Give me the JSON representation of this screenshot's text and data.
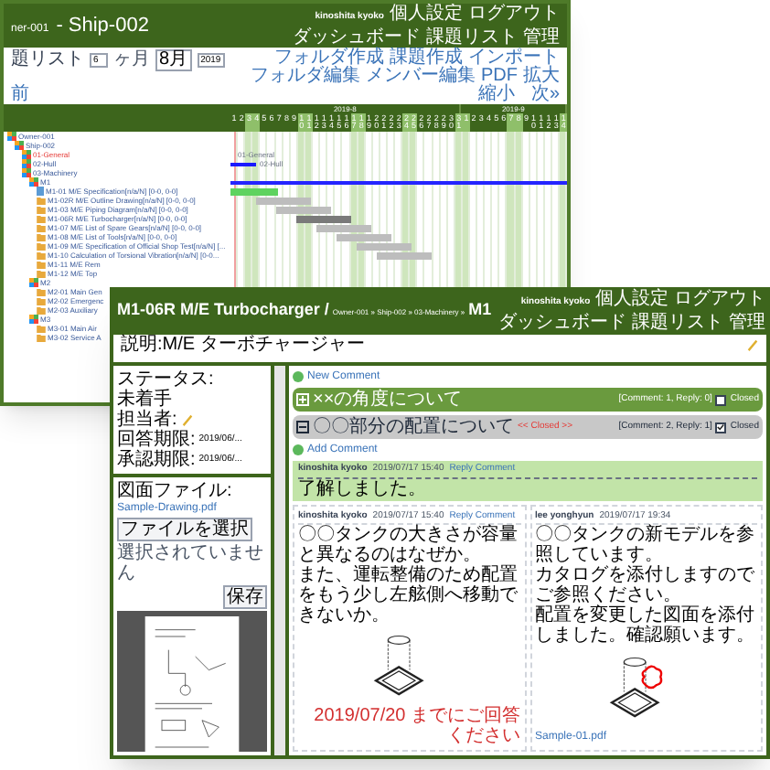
{
  "back_window": {
    "header": {
      "owner": "ner-001",
      "ship": "- Ship-002",
      "user": "kinoshita kyoko",
      "menu_top": [
        "個人設定",
        "ログアウト"
      ],
      "menu_bottom": [
        "ダッシュボード",
        "課題リスト",
        "管理"
      ]
    },
    "toolbar": {
      "title": "題リスト",
      "months": "6",
      "months_label": "ヶ月",
      "month": "8月",
      "year": "2019",
      "actions": [
        "フォルダ作成",
        "課題作成",
        "インポート",
        "フォルダ編集",
        "メンバー編集",
        "PDF",
        "拡大",
        "縮小"
      ]
    },
    "nav": {
      "prev": "前",
      "next": "次»"
    },
    "gantt": {
      "months": [
        "2019-8",
        "2019-9"
      ],
      "days": [
        {
          "label": "1",
          "weekend": false
        },
        {
          "label": "2",
          "weekend": false
        },
        {
          "label": "3",
          "weekend": true
        },
        {
          "label": "4",
          "weekend": true
        },
        {
          "label": "5",
          "weekend": false
        },
        {
          "label": "6",
          "weekend": false
        },
        {
          "label": "7",
          "weekend": false
        },
        {
          "label": "8",
          "weekend": false
        },
        {
          "label": "9",
          "weekend": false
        },
        {
          "label": "10",
          "weekend": true
        },
        {
          "label": "11",
          "weekend": true
        },
        {
          "label": "12",
          "weekend": false
        },
        {
          "label": "13",
          "weekend": false
        },
        {
          "label": "14",
          "weekend": false
        },
        {
          "label": "15",
          "weekend": false
        },
        {
          "label": "16",
          "weekend": false
        },
        {
          "label": "17",
          "weekend": true
        },
        {
          "label": "18",
          "weekend": true
        },
        {
          "label": "19",
          "weekend": false
        },
        {
          "label": "20",
          "weekend": false
        },
        {
          "label": "21",
          "weekend": false
        },
        {
          "label": "22",
          "weekend": false
        },
        {
          "label": "23",
          "weekend": false
        },
        {
          "label": "24",
          "weekend": true
        },
        {
          "label": "25",
          "weekend": true
        },
        {
          "label": "26",
          "weekend": false
        },
        {
          "label": "27",
          "weekend": false
        },
        {
          "label": "28",
          "weekend": false
        },
        {
          "label": "29",
          "weekend": false
        },
        {
          "label": "30",
          "weekend": false
        },
        {
          "label": "31",
          "weekend": true
        },
        {
          "label": "1",
          "weekend": true
        },
        {
          "label": "2",
          "weekend": false
        },
        {
          "label": "3",
          "weekend": false
        },
        {
          "label": "4",
          "weekend": false
        },
        {
          "label": "5",
          "weekend": false
        },
        {
          "label": "6",
          "weekend": false
        },
        {
          "label": "7",
          "weekend": true
        },
        {
          "label": "8",
          "weekend": true
        },
        {
          "label": "9",
          "weekend": false
        },
        {
          "label": "10",
          "weekend": false
        },
        {
          "label": "11",
          "weekend": false
        },
        {
          "label": "12",
          "weekend": false
        },
        {
          "label": "13",
          "weekend": false
        },
        {
          "label": "14",
          "weekend": true
        }
      ]
    },
    "tree": [
      {
        "kind": "group",
        "label": "Owner-001",
        "highlighted": false,
        "children": [
          {
            "kind": "group",
            "label": "Ship-002",
            "highlighted": false,
            "children": [
              {
                "kind": "group",
                "label": "01-General",
                "highlighted": true,
                "bar": {
                  "kind": "label",
                  "label": "01-General"
                }
              },
              {
                "kind": "group",
                "label": "02-Hull",
                "highlighted": false,
                "bar": {
                  "kind": "short",
                  "label": "02-Hull"
                }
              },
              {
                "kind": "group",
                "label": "03-Machinery",
                "highlighted": false,
                "children": [
                  {
                    "kind": "group",
                    "label": "M1",
                    "highlighted": false,
                    "bar": {
                      "kind": "summary"
                    },
                    "children": [
                      {
                        "kind": "doc",
                        "label": "M1-01 M/E Specification[n/a/N] [0-0, 0-0]",
                        "highlighted": false,
                        "bar": {
                          "kind": "done"
                        }
                      },
                      {
                        "kind": "folder",
                        "label": "M1-02R M/E Outline Drawing[n/a/N] [0-0, 0-0]",
                        "highlighted": false,
                        "bar": {
                          "kind": "plan"
                        }
                      },
                      {
                        "kind": "folder",
                        "label": "M1-03 M/E Piping Diagram[n/a/N] [0-0, 0-0]",
                        "highlighted": false,
                        "bar": {
                          "kind": "plan"
                        }
                      },
                      {
                        "kind": "folder",
                        "label": "M1-06R M/E Turbocharger[n/a/N] [0-0, 0-0]",
                        "highlighted": false,
                        "bar": {
                          "kind": "current"
                        }
                      },
                      {
                        "kind": "folder",
                        "label": "M1-07 M/E List of Spare Gears[n/a/N] [0-0, 0-0]",
                        "highlighted": false,
                        "bar": {
                          "kind": "plan"
                        }
                      },
                      {
                        "kind": "folder",
                        "label": "M1-08 M/E List of Tools[n/a/N] [0-0, 0-0]",
                        "highlighted": false,
                        "bar": {
                          "kind": "plan"
                        }
                      },
                      {
                        "kind": "folder",
                        "label": "M1-09 M/E Specification of Official Shop Test[n/a/N] [...",
                        "highlighted": false,
                        "bar": {
                          "kind": "plan"
                        }
                      },
                      {
                        "kind": "folder",
                        "label": "M1-10 Calculation of Torsional Vibration[n/a/N] [0-0...",
                        "highlighted": false,
                        "bar": {
                          "kind": "plan"
                        }
                      },
                      {
                        "kind": "folder",
                        "label": "M1-11 M/E Rem",
                        "highlighted": false
                      },
                      {
                        "kind": "folder",
                        "label": "M1-12 M/E Top",
                        "highlighted": false
                      }
                    ]
                  },
                  {
                    "kind": "group",
                    "label": "M2",
                    "highlighted": false,
                    "children": [
                      {
                        "kind": "folder",
                        "label": "M2-01 Main Gen",
                        "highlighted": false
                      },
                      {
                        "kind": "folder",
                        "label": "M2-02 Emergenc",
                        "highlighted": false
                      },
                      {
                        "kind": "folder",
                        "label": "M2-03 Auxiliary",
                        "highlighted": false
                      }
                    ]
                  },
                  {
                    "kind": "group",
                    "label": "M3",
                    "highlighted": false,
                    "children": [
                      {
                        "kind": "folder",
                        "label": "M3-01 Main Air",
                        "highlighted": false
                      },
                      {
                        "kind": "folder",
                        "label": "M3-02 Service A",
                        "highlighted": false
                      }
                    ]
                  }
                ]
              }
            ]
          }
        ]
      }
    ]
  },
  "front_window": {
    "header": {
      "title": "M1-06R M/E Turbocharger /",
      "breadcrumb": "Owner-001 » Ship-002 » 03-Machinery »",
      "node": "M1",
      "user": "kinoshita kyoko",
      "menu_top": [
        "個人設定",
        "ログアウト"
      ],
      "menu_bottom": [
        "ダッシュボード",
        "課題リスト",
        "管理"
      ]
    },
    "description": "説明:M/E ターボチャージャー",
    "status": {
      "status_label": "ステータス:",
      "status": "未着手",
      "assignee_label": "担当者:",
      "answer_label": "回答期限:",
      "answer_date": "2019/06/...",
      "approval_label": "承認期限:",
      "approval_date": "2019/06/..."
    },
    "file": {
      "label": "図面ファイル:",
      "name": "Sample-Drawing.pdf",
      "choose": "ファイルを選択",
      "none": "選択されていません",
      "save": "保存"
    },
    "new_comment": "New Comment",
    "threads": [
      {
        "title": "××の角度について",
        "summary": "[Comment: 1, Reply: 0]",
        "closed_label": "Closed",
        "closed": false,
        "expanded": false
      },
      {
        "title": "〇〇部分の配置について",
        "closed_tag": "<< Closed >>",
        "summary": "[Comment: 2, Reply: 1]",
        "closed_label": "Closed",
        "closed": true,
        "expanded": true
      }
    ],
    "add_comment": "Add Comment",
    "reply": {
      "author": "kinoshita kyoko",
      "time": "2019/07/17 15:40",
      "action": "Reply Comment",
      "text": "了解しました。"
    },
    "comments": [
      {
        "author": "kinoshita kyoko",
        "time": "2019/07/17 15:40",
        "action": "Reply Comment",
        "lines": [
          "〇〇タンクの大きさが容量と異なるのはなぜか。",
          "また、運転整備のため配置をもう少し左舷側へ移動できないか。"
        ],
        "markup": false,
        "deadline": "2019/07/20 までにご回答ください"
      },
      {
        "author": "lee yonghyun",
        "time": "2019/07/17 19:34",
        "lines": [
          "〇〇タンクの新モデルを参照しています。",
          "カタログを添付しますのでご参照ください。",
          "配置を変更した図面を添付しました。確認願います。"
        ],
        "markup": true,
        "attachment": "Sample-01.pdf"
      }
    ]
  }
}
